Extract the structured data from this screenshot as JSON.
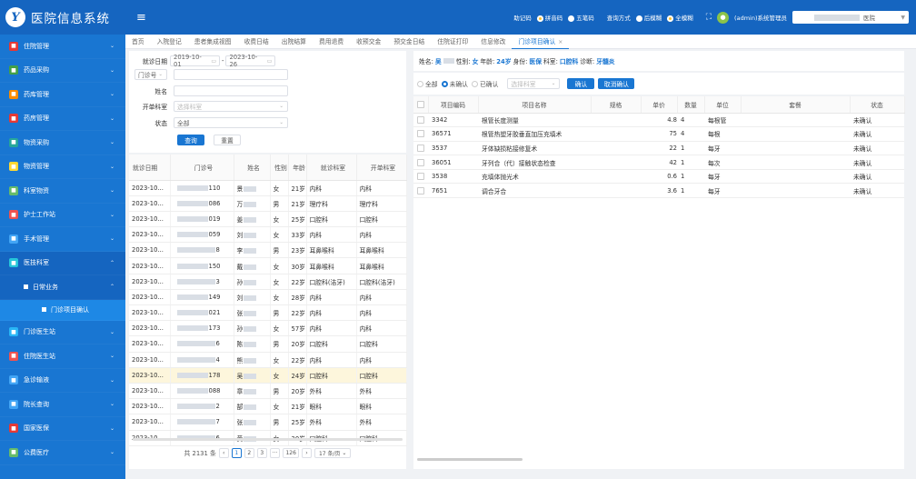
{
  "header": {
    "logo_char": "Y",
    "app_title": "医院信息系统",
    "menu_icon": "hamburger-icon",
    "mnemonic_label": "助记码",
    "mnemonic_options": [
      {
        "label": "拼音码",
        "selected": true
      },
      {
        "label": "五笔码",
        "selected": false
      }
    ],
    "query_label": "查询方式",
    "query_options": [
      {
        "label": "后模糊",
        "selected": false
      },
      {
        "label": "全模糊",
        "selected": true
      }
    ],
    "user_label": "(admin)系统管理员",
    "dept_suffix": "医院",
    "accent": "#1565c0"
  },
  "sidebar": {
    "items": [
      {
        "label": "住院管理",
        "icon_color": "#e53935",
        "icon": "inpatient-icon",
        "chev": "⌄"
      },
      {
        "label": "药品采购",
        "icon_color": "#43a047",
        "icon": "pill-icon",
        "chev": "⌄"
      },
      {
        "label": "药库管理",
        "icon_color": "#fb8c00",
        "icon": "warehouse-icon",
        "chev": "⌄"
      },
      {
        "label": "药房管理",
        "icon_color": "#e53935",
        "icon": "pharmacy-icon",
        "chev": "⌄"
      },
      {
        "label": "物资采购",
        "icon_color": "#26a69a",
        "icon": "cart-icon",
        "chev": "⌄"
      },
      {
        "label": "物资管理",
        "icon_color": "#fdd835",
        "icon": "box-icon",
        "chev": "⌄"
      },
      {
        "label": "科室物资",
        "icon_color": "#66bb6a",
        "icon": "dept-supply-icon",
        "chev": "⌄"
      },
      {
        "label": "护士工作站",
        "icon_color": "#ef5350",
        "icon": "nurse-icon",
        "chev": "⌄"
      },
      {
        "label": "手术管理",
        "icon_color": "#42a5f5",
        "icon": "surgery-icon",
        "chev": "⌄"
      },
      {
        "label": "医技科室",
        "icon_color": "#26c6da",
        "icon": "medtech-icon",
        "chev": "⌃"
      }
    ],
    "sub_item": {
      "label": "日常业务",
      "chev": "⌃"
    },
    "subsub_item": {
      "label": "门诊项目确认"
    },
    "items_after": [
      {
        "label": "门诊医生站",
        "icon_color": "#29b6f6",
        "icon": "outpatient-doctor-icon",
        "chev": "⌄"
      },
      {
        "label": "住院医生站",
        "icon_color": "#ef5350",
        "icon": "inpatient-doctor-icon",
        "chev": "⌄"
      },
      {
        "label": "急诊输液",
        "icon_color": "#42a5f5",
        "icon": "infusion-icon",
        "chev": "⌄"
      },
      {
        "label": "院长查询",
        "icon_color": "#42a5f5",
        "icon": "director-icon",
        "chev": "⌄"
      },
      {
        "label": "国家医保",
        "icon_color": "#e53935",
        "icon": "insurance-icon",
        "chev": "⌄"
      },
      {
        "label": "公费医疗",
        "icon_color": "#66bb6a",
        "icon": "public-medical-icon",
        "chev": "⌄"
      }
    ]
  },
  "tabs": [
    {
      "label": "首页"
    },
    {
      "label": "入院登记"
    },
    {
      "label": "患者集成视图"
    },
    {
      "label": "收费日结"
    },
    {
      "label": "出院结算"
    },
    {
      "label": "费用退费"
    },
    {
      "label": "收预交金"
    },
    {
      "label": "预交金日结"
    },
    {
      "label": "住院证打印"
    },
    {
      "label": "信息修改"
    },
    {
      "label": "门诊项目确认",
      "active": true
    }
  ],
  "filter": {
    "date_label": "就诊日期",
    "date_from": "2019-10-01",
    "date_sep": "-",
    "date_to": "2023-10-26",
    "id_type": "门诊号",
    "name_label": "姓名",
    "dept_label": "开单科室",
    "dept_placeholder": "选择科室",
    "status_label": "状态",
    "status_value": "全部",
    "query_button": "查询",
    "reset_button": "重置"
  },
  "left_table": {
    "columns": [
      "就诊日期",
      "门诊号",
      "姓名",
      "性别",
      "年龄",
      "就诊科室",
      "开单科室"
    ],
    "rows": [
      {
        "date": "2023-10...",
        "id": "110",
        "name": "景",
        "sex": "女",
        "age": "21岁",
        "dept": "内科",
        "order_dept": "内科"
      },
      {
        "date": "2023-10...",
        "id": "086",
        "name": "万",
        "sex": "男",
        "age": "21岁",
        "dept": "理疗科",
        "order_dept": "理疗科"
      },
      {
        "date": "2023-10...",
        "id": "019",
        "name": "姜",
        "sex": "女",
        "age": "25岁",
        "dept": "口腔科",
        "order_dept": "口腔科"
      },
      {
        "date": "2023-10...",
        "id": "059",
        "name": "刘",
        "sex": "女",
        "age": "33岁",
        "dept": "内科",
        "order_dept": "内科"
      },
      {
        "date": "2023-10...",
        "id": "8",
        "name": "李",
        "sex": "男",
        "age": "23岁",
        "dept": "耳鼻喉科",
        "order_dept": "耳鼻喉科"
      },
      {
        "date": "2023-10...",
        "id": "150",
        "name": "戴",
        "sex": "女",
        "age": "30岁",
        "dept": "耳鼻喉科",
        "order_dept": "耳鼻喉科"
      },
      {
        "date": "2023-10...",
        "id": "3",
        "name": "孙",
        "sex": "女",
        "age": "22岁",
        "dept": "口腔科(洁牙)",
        "order_dept": "口腔科(洁牙)"
      },
      {
        "date": "2023-10...",
        "id": "149",
        "name": "刘",
        "sex": "女",
        "age": "28岁",
        "dept": "内科",
        "order_dept": "内科"
      },
      {
        "date": "2023-10...",
        "id": "021",
        "name": "张",
        "sex": "男",
        "age": "22岁",
        "dept": "内科",
        "order_dept": "内科"
      },
      {
        "date": "2023-10...",
        "id": "173",
        "name": "孙",
        "sex": "女",
        "age": "57岁",
        "dept": "内科",
        "order_dept": "内科"
      },
      {
        "date": "2023-10...",
        "id": "6",
        "name": "陈",
        "sex": "男",
        "age": "20岁",
        "dept": "口腔科",
        "order_dept": "口腔科"
      },
      {
        "date": "2023-10...",
        "id": "4",
        "name": "熊",
        "sex": "女",
        "age": "22岁",
        "dept": "内科",
        "order_dept": "内科"
      },
      {
        "date": "2023-10...",
        "id": "178",
        "name": "吴",
        "sex": "女",
        "age": "24岁",
        "dept": "口腔科",
        "order_dept": "口腔科",
        "selected": true
      },
      {
        "date": "2023-10...",
        "id": "088",
        "name": "章",
        "sex": "男",
        "age": "20岁",
        "dept": "外科",
        "order_dept": "外科"
      },
      {
        "date": "2023-10...",
        "id": "2",
        "name": "郜",
        "sex": "女",
        "age": "21岁",
        "dept": "眼科",
        "order_dept": "眼科"
      },
      {
        "date": "2023-10...",
        "id": "7",
        "name": "张",
        "sex": "男",
        "age": "25岁",
        "dept": "外科",
        "order_dept": "外科"
      },
      {
        "date": "2023-10...",
        "id": "6",
        "name": "黄",
        "sex": "女",
        "age": "20岁",
        "dept": "口腔科",
        "order_dept": "口腔科"
      }
    ],
    "pager": {
      "total_label": "共 2131 条",
      "pages": [
        "1",
        "2",
        "3",
        "···",
        "126"
      ],
      "current": "1",
      "page_size": "17 条/页"
    }
  },
  "patient_info": {
    "name_key": "姓名:",
    "name_val": "吴",
    "sex_key": "性别:",
    "sex_val": "女",
    "age_key": "年龄:",
    "age_val": "24岁",
    "identity_key": "身份:",
    "identity_val": "医保",
    "dept_key": "科室:",
    "dept_val": "口腔科",
    "diag_key": "诊断:",
    "diag_val": "牙髓炎"
  },
  "right_toolbar": {
    "options": [
      {
        "label": "全部",
        "selected": false
      },
      {
        "label": "未确认",
        "selected": true
      },
      {
        "label": "已确认",
        "selected": false
      }
    ],
    "dept_placeholder": "选择科室",
    "confirm_button": "确认",
    "cancel_button": "取消确认"
  },
  "right_table": {
    "columns": [
      "项目编码",
      "项目名称",
      "规格",
      "单价",
      "数量",
      "单位",
      "套餐",
      "状态"
    ],
    "rows": [
      {
        "code": "3342",
        "name": "根管长度测量",
        "spec": "",
        "price": "4.8",
        "qty": "4",
        "unit": "每根管",
        "pkg": "",
        "status": "未确认"
      },
      {
        "code": "36571",
        "name": "根管热塑牙胶垂直加压充填术",
        "spec": "",
        "price": "75",
        "qty": "4",
        "unit": "每根",
        "pkg": "",
        "status": "未确认"
      },
      {
        "code": "3537",
        "name": "牙体缺损粘接修复术",
        "spec": "",
        "price": "22",
        "qty": "1",
        "unit": "每牙",
        "pkg": "",
        "status": "未确认"
      },
      {
        "code": "36051",
        "name": "牙列合（代）接触状态检查",
        "spec": "",
        "price": "42",
        "qty": "1",
        "unit": "每次",
        "pkg": "",
        "status": "未确认"
      },
      {
        "code": "3538",
        "name": "充填体抛光术",
        "spec": "",
        "price": "0.6",
        "qty": "1",
        "unit": "每牙",
        "pkg": "",
        "status": "未确认"
      },
      {
        "code": "7651",
        "name": "调合牙合",
        "spec": "",
        "price": "3.6",
        "qty": "1",
        "unit": "每牙",
        "pkg": "",
        "status": "未确认"
      }
    ]
  }
}
